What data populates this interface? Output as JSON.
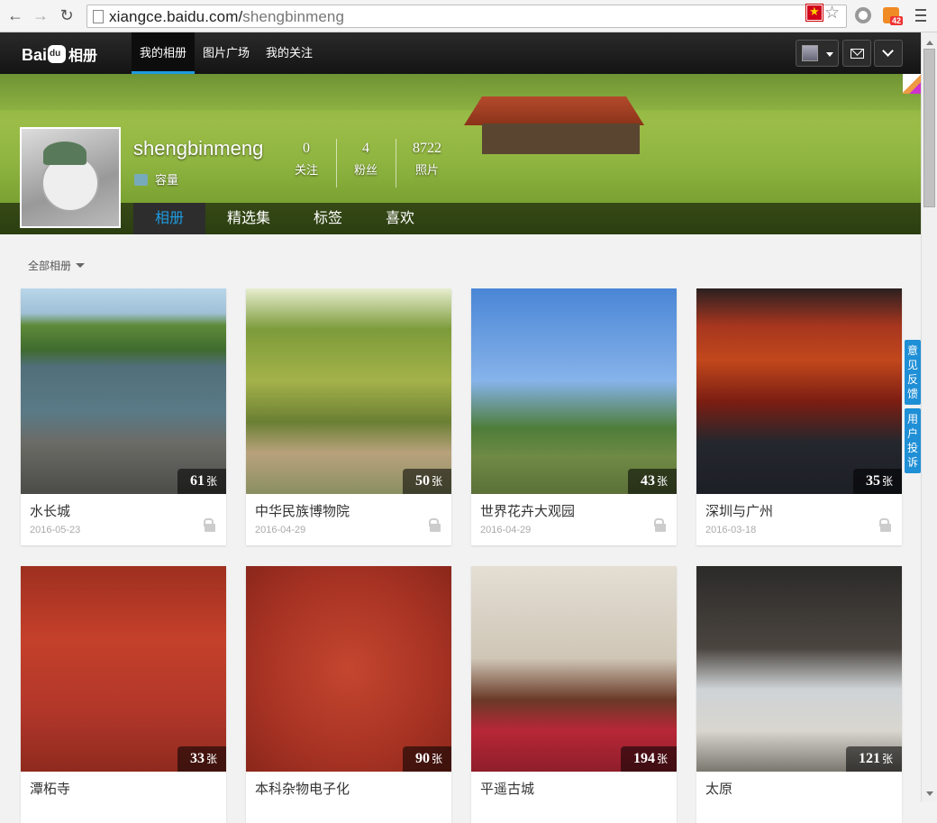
{
  "browser": {
    "url_host": "xiangce.baidu.com/",
    "url_path": "shengbinmeng",
    "rss_badge": "42"
  },
  "site": {
    "logo_text": "Bai",
    "logo_cn": "相册",
    "nav": [
      {
        "label": "我的相册"
      },
      {
        "label": "图片广场"
      },
      {
        "label": "我的关注"
      }
    ]
  },
  "profile": {
    "username": "shengbinmeng",
    "quota_label": "容量",
    "stats": [
      {
        "value": "0",
        "label": "关注"
      },
      {
        "value": "4",
        "label": "粉丝"
      },
      {
        "value": "8722",
        "label": "照片"
      }
    ],
    "tabs": [
      {
        "label": "相册"
      },
      {
        "label": "精选集"
      },
      {
        "label": "标签"
      },
      {
        "label": "喜欢"
      }
    ]
  },
  "filter": {
    "label": "全部相册"
  },
  "count_unit": "张",
  "albums": [
    {
      "title": "水长城",
      "date": "2016-05-23",
      "count": "61"
    },
    {
      "title": "中华民族博物院",
      "date": "2016-04-29",
      "count": "50"
    },
    {
      "title": "世界花卉大观园",
      "date": "2016-04-29",
      "count": "43"
    },
    {
      "title": "深圳与广州",
      "date": "2016-03-18",
      "count": "35"
    },
    {
      "title": "潭柘寺",
      "date": "",
      "count": "33"
    },
    {
      "title": "本科杂物电子化",
      "date": "",
      "count": "90"
    },
    {
      "title": "平遥古城",
      "date": "",
      "count": "194"
    },
    {
      "title": "太原",
      "date": "",
      "count": "121"
    }
  ],
  "feedback": [
    {
      "label": "意见反馈"
    },
    {
      "label": "用户投诉"
    }
  ],
  "photo_colors": [
    "#6f8f9f",
    "#7d8f4a",
    "#6d93c9",
    "#8b2a1e",
    "#a8271b",
    "#a83324",
    "#c9c1b3",
    "#3d3a37"
  ]
}
